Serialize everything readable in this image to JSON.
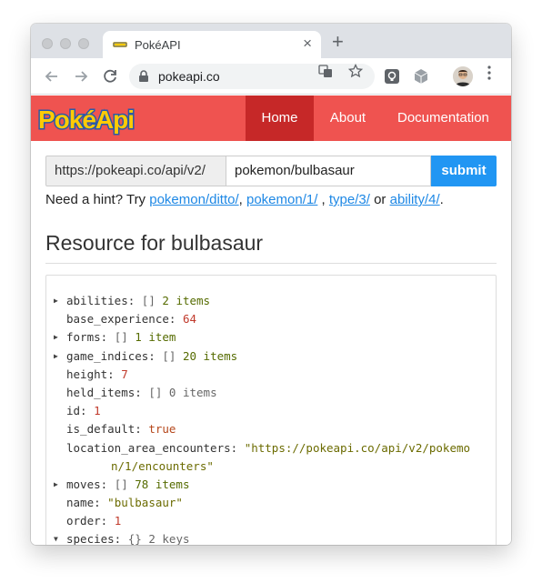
{
  "browser": {
    "tab_title": "PokéAPI",
    "new_tab_symbol": "+",
    "close_symbol": "×",
    "url": "pokeapi.co"
  },
  "site": {
    "logo_text": "PokéApi",
    "nav": {
      "home": "Home",
      "about": "About",
      "documentation": "Documentation"
    },
    "colors": {
      "brand": "#ef5350",
      "active": "#c62828",
      "submit": "#2196f3",
      "link": "#1e88e5"
    }
  },
  "search": {
    "prefix": "https://pokeapi.co/api/v2/",
    "value": "pokemon/bulbasaur",
    "submit_label": "submit"
  },
  "hint": {
    "lead": "Need a hint? Try ",
    "link1": "pokemon/ditto/",
    "sep1": ", ",
    "link2": "pokemon/1/",
    "sep2": " , ",
    "link3": "type/3/",
    "sep3": " or ",
    "link4": "ability/4/",
    "end": "."
  },
  "resource": {
    "heading": "Resource for bulbasaur",
    "rows": {
      "abilities": {
        "key": "abilities:",
        "bracket": "[]",
        "count": "2 items"
      },
      "base_experience": {
        "key": "base_experience:",
        "value": "64"
      },
      "forms": {
        "key": "forms:",
        "bracket": "[]",
        "count": "1 item"
      },
      "game_indices": {
        "key": "game_indices:",
        "bracket": "[]",
        "count": "20 items"
      },
      "height": {
        "key": "height:",
        "value": "7"
      },
      "held_items": {
        "key": "held_items:",
        "bracket": "[]",
        "count": "0 items"
      },
      "id": {
        "key": "id:",
        "value": "1"
      },
      "is_default": {
        "key": "is_default:",
        "value": "true"
      },
      "location_area_encounters": {
        "key": "location_area_encounters:",
        "value_line1": "\"https://pokeapi.co/api/v2/pokemo",
        "value_line2": "n/1/encounters\""
      },
      "moves": {
        "key": "moves:",
        "bracket": "[]",
        "count": "78 items"
      },
      "name": {
        "key": "name:",
        "value": "\"bulbasaur\""
      },
      "order": {
        "key": "order:",
        "value": "1"
      },
      "species": {
        "key": "species:",
        "bracket": "{}",
        "count": "2 keys"
      }
    }
  }
}
